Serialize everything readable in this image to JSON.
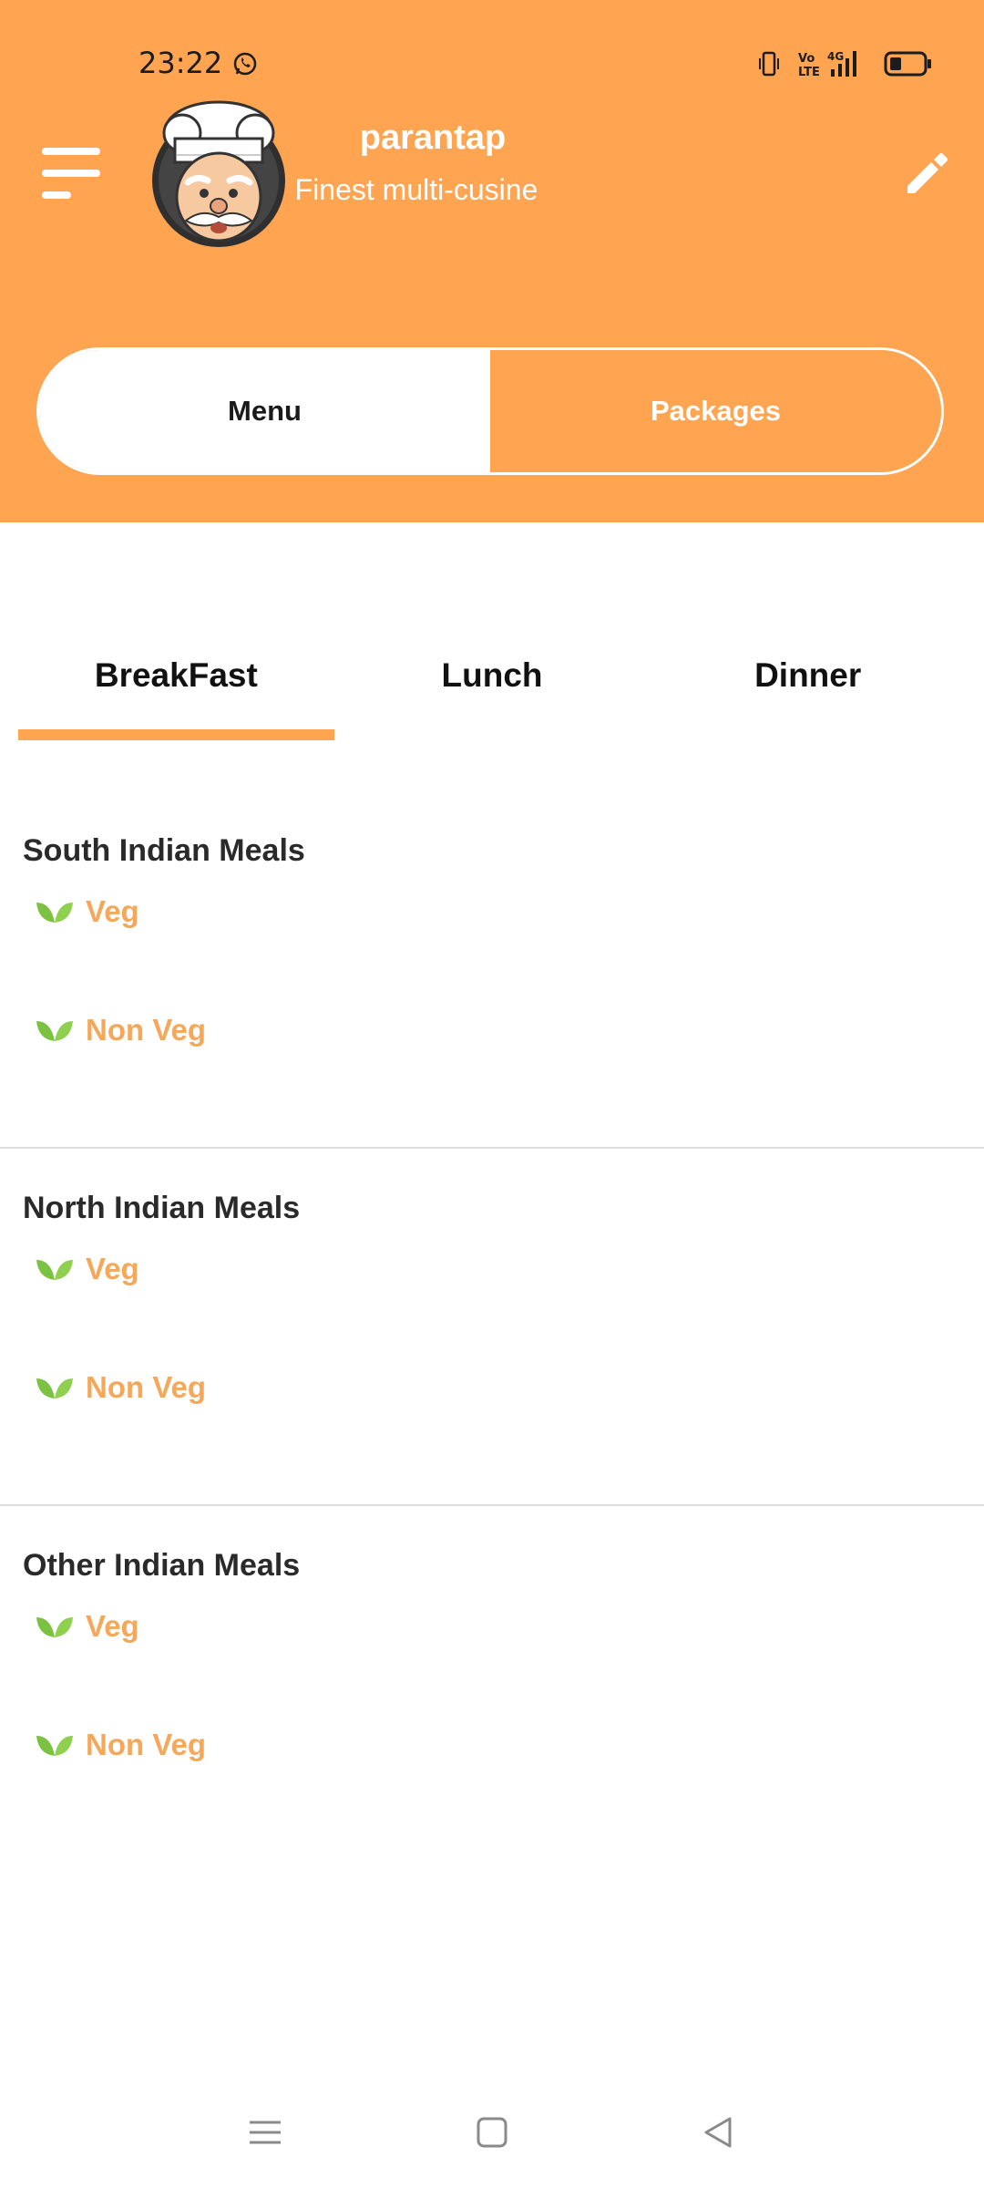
{
  "status_bar": {
    "time": "23:22",
    "icons": [
      "whatsapp-icon",
      "vibrate-icon",
      "volte-icon",
      "4g-signal-icon",
      "battery-icon"
    ]
  },
  "header": {
    "title": "parantap",
    "subtitle": "Finest multi-cusine",
    "menu_icon": "hamburger-icon",
    "edit_icon": "pencil-icon",
    "accent_color": "#ffa552"
  },
  "segment": {
    "menu_label": "Menu",
    "packages_label": "Packages",
    "selected": "Menu"
  },
  "meal_tabs": {
    "items": [
      {
        "label": "BreakFast"
      },
      {
        "label": "Lunch"
      },
      {
        "label": "Dinner"
      }
    ],
    "selected": "BreakFast"
  },
  "sections": [
    {
      "title": "South Indian Meals",
      "options": [
        {
          "label": "Veg"
        },
        {
          "label": "Non Veg"
        }
      ]
    },
    {
      "title": "North Indian Meals",
      "options": [
        {
          "label": "Veg"
        },
        {
          "label": "Non Veg"
        }
      ]
    },
    {
      "title": "Other Indian Meals",
      "options": [
        {
          "label": "Veg"
        },
        {
          "label": "Non Veg"
        }
      ]
    }
  ],
  "nav_bar": {
    "icons": [
      "recents-icon",
      "home-icon",
      "back-icon"
    ]
  }
}
